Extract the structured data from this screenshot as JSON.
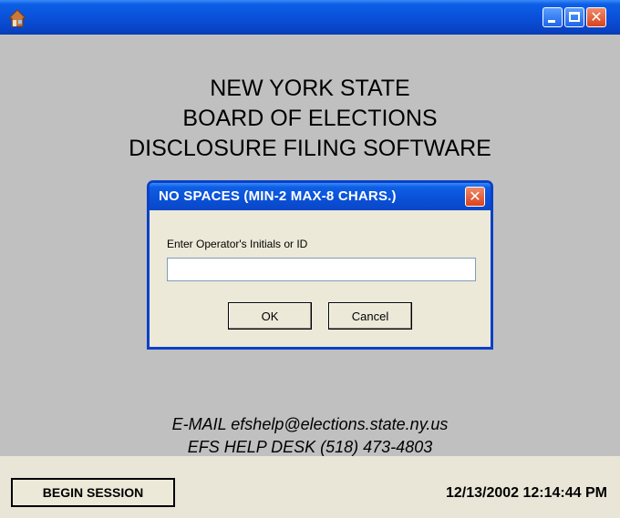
{
  "window": {
    "app_icon": "house-icon",
    "min_icon": "minimize-icon",
    "max_icon": "maximize-icon",
    "close_icon": "close-icon",
    "close_glyph": "✕"
  },
  "main": {
    "heading_line1": "NEW YORK STATE",
    "heading_line2": "BOARD OF ELECTIONS",
    "heading_line3": "DISCLOSURE FILING SOFTWARE",
    "email_line": "E-MAIL efshelp@elections.state.ny.us",
    "helpdesk_line": "EFS HELP DESK (518) 473-4803"
  },
  "dialog": {
    "title": "NO SPACES (MIN-2 MAX-8 CHARS.)",
    "close_glyph": "✕",
    "prompt": "Enter Operator's Initials or ID",
    "input_value": "",
    "ok_label": "OK",
    "cancel_label": "Cancel"
  },
  "bottombar": {
    "begin_label": "BEGIN SESSION",
    "datetime": "12/13/2002 12:14:44 PM"
  }
}
